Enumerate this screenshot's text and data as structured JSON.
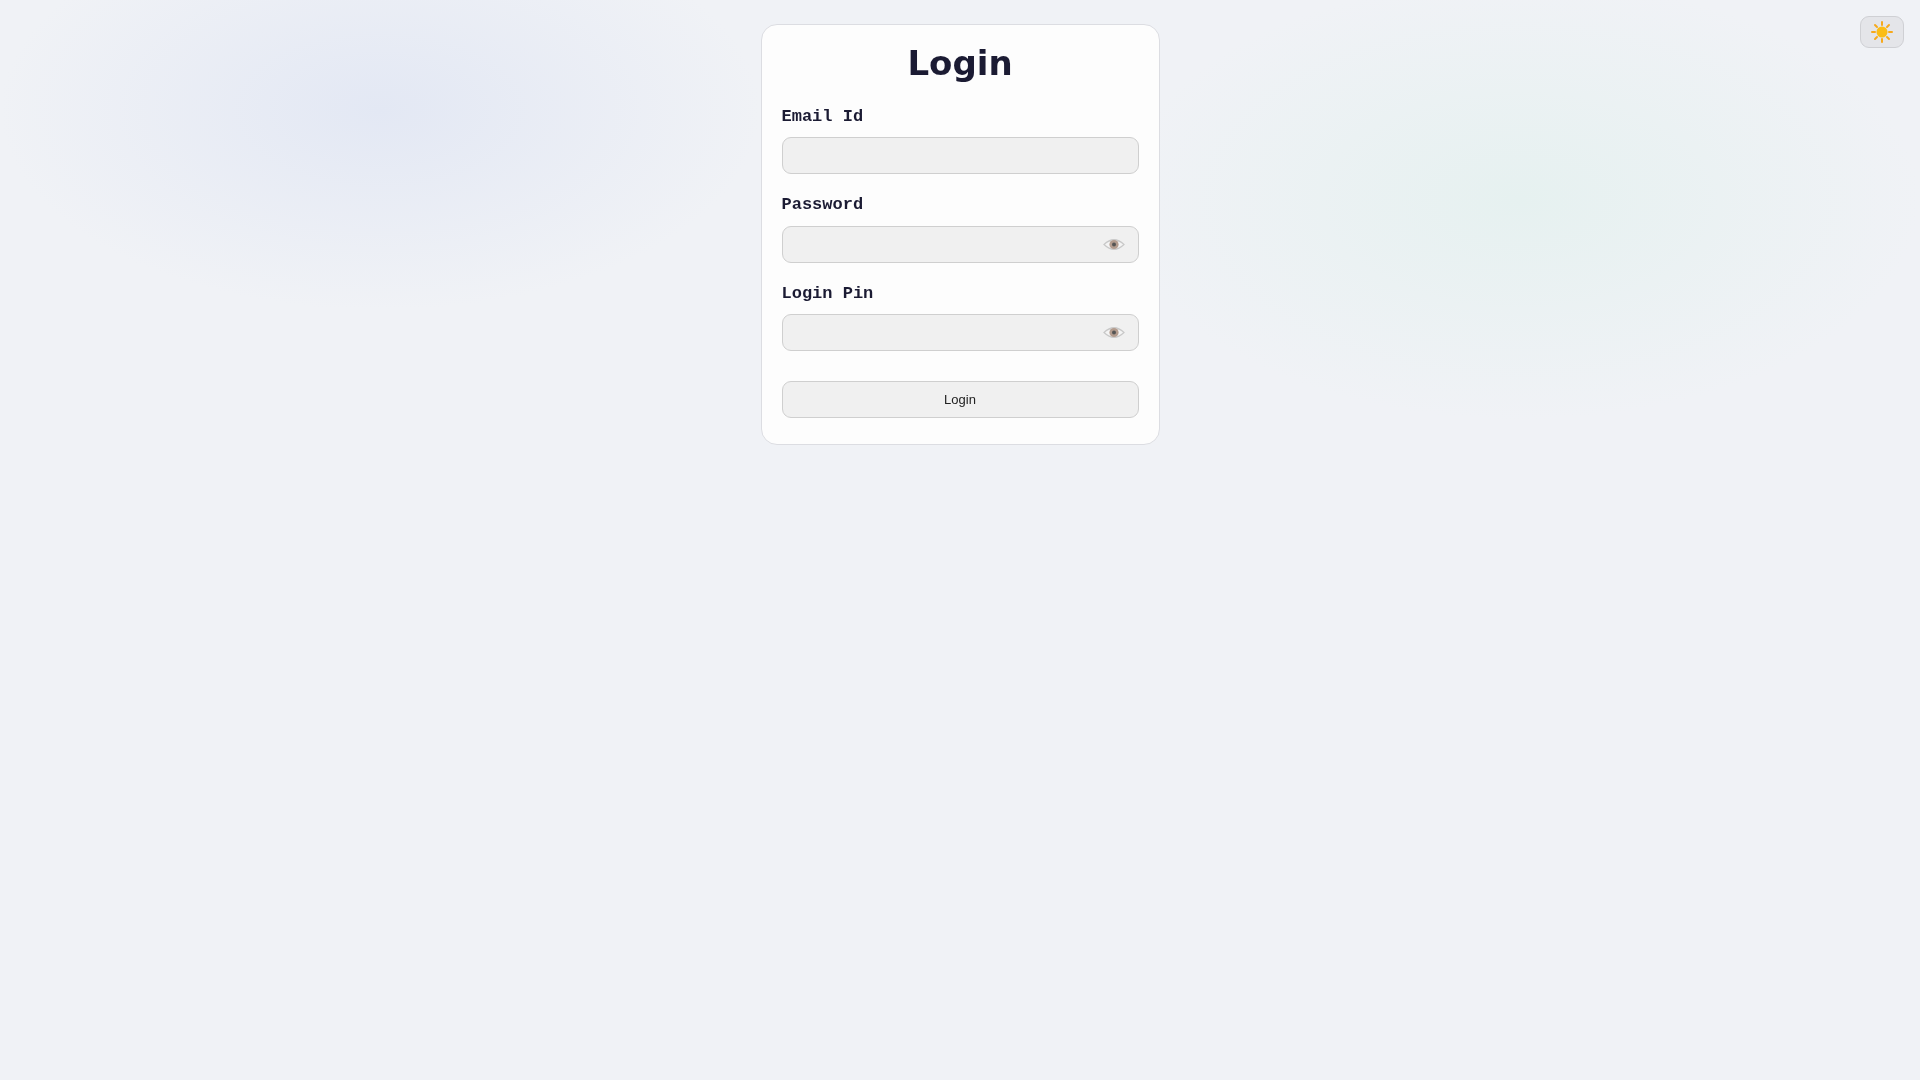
{
  "title": "Login",
  "fields": [
    {
      "label": "Email Id",
      "kind": "plain"
    },
    {
      "label": "Password",
      "kind": "secret"
    },
    {
      "label": "Login Pin",
      "kind": "secret"
    }
  ],
  "submit": "Login"
}
